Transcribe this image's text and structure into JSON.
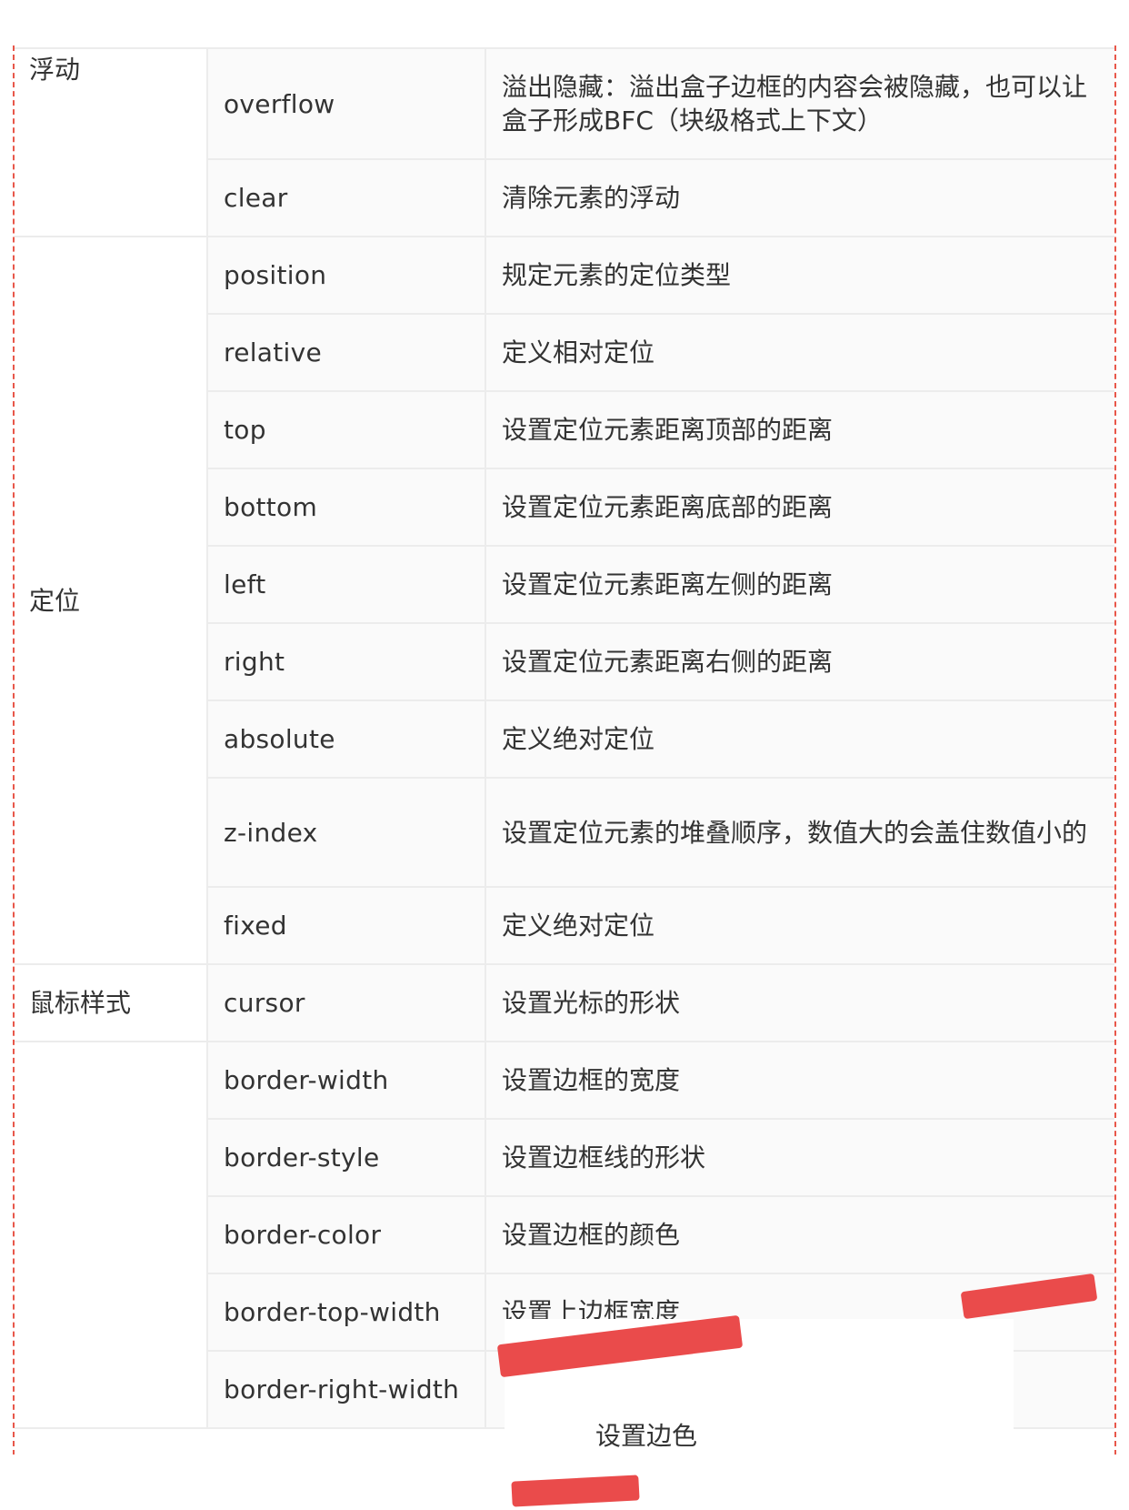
{
  "rows": [
    {
      "category": "浮动",
      "prop": "overflow",
      "desc": "溢出隐藏：溢出盒子边框的内容会被隐藏，也可以让盒子形成BFC（块级格式上下文）"
    },
    {
      "category": "",
      "prop": "clear",
      "desc": "清除元素的浮动"
    },
    {
      "category": "定位",
      "prop": "position",
      "desc": "规定元素的定位类型"
    },
    {
      "category": "",
      "prop": "relative",
      "desc": "定义相对定位"
    },
    {
      "category": "",
      "prop": "top",
      "desc": "设置定位元素距离顶部的距离"
    },
    {
      "category": "",
      "prop": "bottom",
      "desc": "设置定位元素距离底部的距离"
    },
    {
      "category": "",
      "prop": "left",
      "desc": "设置定位元素距离左侧的距离"
    },
    {
      "category": "",
      "prop": "right",
      "desc": "设置定位元素距离右侧的距离"
    },
    {
      "category": "",
      "prop": "absolute",
      "desc": "定义绝对定位"
    },
    {
      "category": "",
      "prop": "z-index",
      "desc": "设置定位元素的堆叠顺序，数值大的会盖住数值小的"
    },
    {
      "category": "",
      "prop": "fixed",
      "desc": "定义绝对定位"
    },
    {
      "category": "鼠标样式",
      "prop": "cursor",
      "desc": "设置光标的形状"
    },
    {
      "category": "",
      "prop": "border-width",
      "desc": "设置边框的宽度"
    },
    {
      "category": "",
      "prop": "border-style",
      "desc": "设置边框线的形状"
    },
    {
      "category": "",
      "prop": "border-color",
      "desc": "设置边框的颜色"
    },
    {
      "category": "",
      "prop": "border-top-width",
      "desc": "设置上边框宽度"
    },
    {
      "category": "",
      "prop": "border-right-width",
      "desc": ""
    }
  ],
  "overlay_text": "设置边色",
  "colors": {
    "dashed_border": "#e8574a",
    "cell_border": "#ececec",
    "text": "#333333",
    "red_stroke": "#ea4b4b"
  }
}
